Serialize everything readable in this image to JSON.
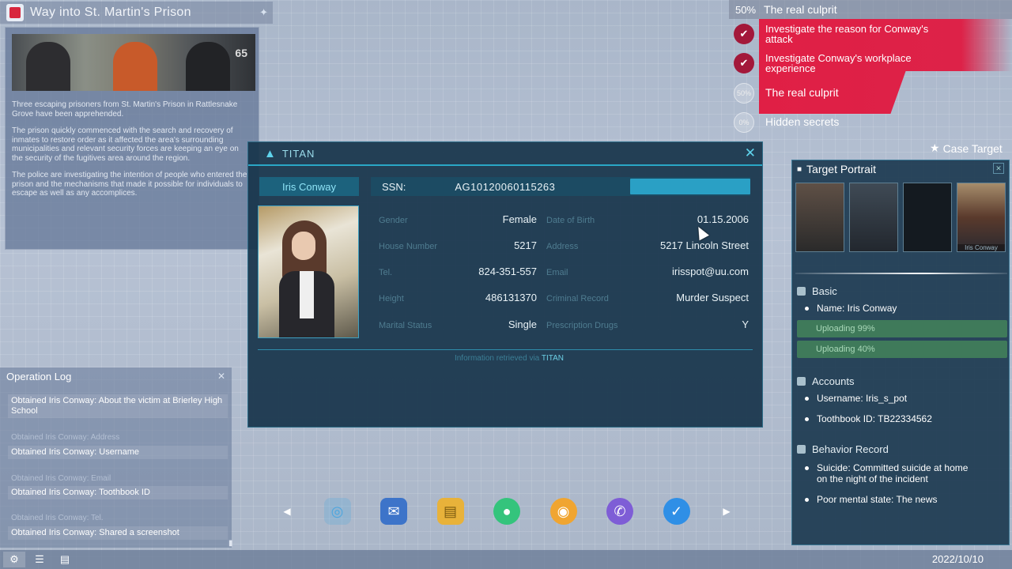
{
  "news": {
    "title": "Way into St. Martin's Prison",
    "image_tag": "65",
    "paragraphs": [
      "Three escaping prisoners from St. Martin's Prison in Rattlesnake Grove have been apprehended.",
      "The prison quickly commenced with the search and recovery of inmates to restore order as it affected the area's surrounding municipalities and relevant security forces are keeping an eye on the security of the fugitives area around the region.",
      "The police are investigating the intention of people who entered the prison and the mechanisms that made it possible for individuals to escape as well as any accomplices."
    ]
  },
  "case": {
    "progress": "50%",
    "name": "The real culprit",
    "objectives": [
      {
        "status": "done",
        "icon": "check-icon",
        "text": "Investigate the reason for Conway's attack"
      },
      {
        "status": "done",
        "icon": "check-icon",
        "text": "Investigate Conway's workplace experience"
      },
      {
        "status": "progress",
        "badge": "50%",
        "text": "The real culprit"
      },
      {
        "status": "locked",
        "badge": "0%",
        "text": "Hidden secrets"
      }
    ],
    "target_link": "Case Target"
  },
  "database": {
    "app_name": "TITAN",
    "person_name": "Iris Conway",
    "ssn_label": "SSN:",
    "ssn_value": "AG10120060115263",
    "left_fields": [
      {
        "label": "Gender",
        "value": "Female"
      },
      {
        "label": "House Number",
        "value": "5217"
      },
      {
        "label": "Tel.",
        "value": "824-351-557"
      },
      {
        "label": "Height",
        "value": "486131370"
      },
      {
        "label": "Marital Status",
        "value": "Single"
      }
    ],
    "right_fields": [
      {
        "label": "Date of Birth",
        "value": "01.15.2006"
      },
      {
        "label": "Address",
        "value": "5217 Lincoln Street"
      },
      {
        "label": "Email",
        "value": "irisspot@uu.com"
      },
      {
        "label": "Criminal Record",
        "value": "Murder Suspect"
      },
      {
        "label": "Prescription Drugs",
        "value": "Y"
      }
    ],
    "footer_note": "Information retrieved via",
    "footer_link": "TITAN"
  },
  "oplog": {
    "title": "Operation Log",
    "entries": [
      {
        "text": "Obtained Iris Conway: About the victim at Brierley High School",
        "dim": false
      },
      {
        "text": "Obtained Iris Conway: Address",
        "dim": true
      },
      {
        "text": "Obtained Iris Conway: Username",
        "dim": false
      },
      {
        "text": "Obtained Iris Conway: Email",
        "dim": true
      },
      {
        "text": "Obtained Iris Conway: Toothbook ID",
        "dim": false
      },
      {
        "text": "Obtained Iris Conway: Tel.",
        "dim": true
      },
      {
        "text": "Obtained Iris Conway: Shared a screenshot",
        "dim": false
      }
    ]
  },
  "dock": {
    "apps": [
      {
        "name": "browser-app-icon",
        "glyph": "◎",
        "color": "#4aa6e0"
      },
      {
        "name": "mail-app-icon",
        "glyph": "✉",
        "color": "#3d74c9"
      },
      {
        "name": "notes-app-icon",
        "glyph": "▤",
        "color": "#e8b23a"
      },
      {
        "name": "map-app-icon",
        "glyph": "●",
        "color": "#34c47c"
      },
      {
        "name": "chat-app-icon",
        "glyph": "◉",
        "color": "#f0a531"
      },
      {
        "name": "phone-app-icon",
        "glyph": "✆",
        "color": "#7e5dd6"
      },
      {
        "name": "search-app-icon",
        "glyph": "✓",
        "color": "#2f8fe6"
      }
    ]
  },
  "portrait": {
    "title": "Target Portrait",
    "thumbs": [
      "",
      "",
      "",
      "Iris Conway"
    ],
    "basic_title": "Basic",
    "name_item": "Name: Iris Conway",
    "uploading_1": "Uploading 99%",
    "uploading_2": "Uploading 40%",
    "accounts_title": "Accounts",
    "username_item": "Username: Iris_s_pot",
    "toothbook_item": "Toothbook ID: TB22334562",
    "behavior_title": "Behavior Record",
    "behavior_1": "Suicide: Committed suicide at home on the night of the incident",
    "behavior_2": "Poor mental state: The news mentioned a history of mental"
  },
  "taskbar": {
    "date": "2022/10/10"
  }
}
